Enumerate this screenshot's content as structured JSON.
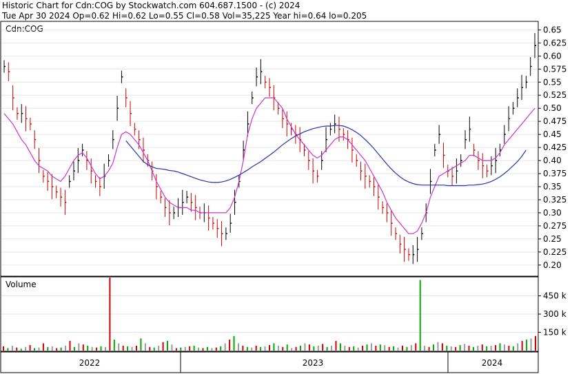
{
  "header": {
    "title": "Historic Chart for Cdn:COG by Stockwatch.com 604.687.1500 - (c) 2024",
    "stats": "Tue Apr 30 2024  Op=0.62  Hi=0.62  Lo=0.55  Cl=0.58  Vol=35,225  Year hi=0.64  lo=0.205"
  },
  "colors": {
    "up": "#000000",
    "down": "#cc0000",
    "ma_short": "#cc33cc",
    "ma_long": "#2233aa",
    "vol_up": "#00aa00",
    "vol_down": "#cc0000",
    "vol_neutral": "#999999"
  },
  "chart_data": [
    {
      "type": "line",
      "label": "Cdn:COG",
      "y_ticks": [
        "0.65",
        "0.625",
        "0.60",
        "0.575",
        "0.55",
        "0.525",
        "0.50",
        "0.475",
        "0.45",
        "0.425",
        "0.40",
        "0.375",
        "0.35",
        "0.325",
        "0.30",
        "0.275",
        "0.25",
        "0.225",
        "0.20"
      ],
      "ylim": [
        0.18,
        0.665
      ],
      "x_labels": [
        "2022",
        "2023",
        "2024"
      ],
      "series": [
        {
          "name": "",
          "style": "ohlc",
          "values": [
            0.58,
            0.57,
            0.52,
            0.49,
            0.49,
            0.48,
            0.47,
            0.44,
            0.4,
            0.37,
            0.36,
            0.35,
            0.34,
            0.33,
            0.32,
            0.36,
            0.38,
            0.4,
            0.42,
            0.4,
            0.38,
            0.36,
            0.35,
            0.37,
            0.4,
            0.44,
            0.5,
            0.56,
            0.52,
            0.49,
            0.46,
            0.44,
            0.42,
            0.4,
            0.38,
            0.35,
            0.33,
            0.31,
            0.3,
            0.3,
            0.31,
            0.32,
            0.33,
            0.32,
            0.31,
            0.3,
            0.3,
            0.29,
            0.28,
            0.27,
            0.26,
            0.26,
            0.28,
            0.32,
            0.36,
            0.42,
            0.47,
            0.52,
            0.56,
            0.57,
            0.55,
            0.54,
            0.52,
            0.5,
            0.48,
            0.47,
            0.46,
            0.45,
            0.44,
            0.42,
            0.4,
            0.38,
            0.37,
            0.4,
            0.44,
            0.46,
            0.47,
            0.46,
            0.45,
            0.44,
            0.42,
            0.4,
            0.38,
            0.37,
            0.36,
            0.35,
            0.33,
            0.31,
            0.3,
            0.28,
            0.26,
            0.24,
            0.23,
            0.22,
            0.22,
            0.23,
            0.26,
            0.3,
            0.36,
            0.42,
            0.45,
            0.41,
            0.38,
            0.37,
            0.38,
            0.4,
            0.44,
            0.46,
            0.42,
            0.4,
            0.39,
            0.38,
            0.39,
            0.4,
            0.42,
            0.45,
            0.48,
            0.5,
            0.52,
            0.54,
            0.55,
            0.58,
            0.62
          ]
        },
        {
          "name": "",
          "values": [
            0.49,
            0.48,
            0.47,
            0.455,
            0.44,
            0.43,
            0.415,
            0.4,
            0.39,
            0.385,
            0.38,
            0.37,
            0.365,
            0.36,
            0.37,
            0.385,
            0.4,
            0.41,
            0.415,
            0.405,
            0.39,
            0.375,
            0.365,
            0.37,
            0.38,
            0.395,
            0.425,
            0.45,
            0.455,
            0.45,
            0.44,
            0.43,
            0.415,
            0.4,
            0.38,
            0.36,
            0.345,
            0.33,
            0.32,
            0.315,
            0.31,
            0.31,
            0.31,
            0.305,
            0.305,
            0.3,
            0.3,
            0.3,
            0.3,
            0.3,
            0.3,
            0.3,
            0.31,
            0.33,
            0.36,
            0.4,
            0.45,
            0.48,
            0.5,
            0.51,
            0.52,
            0.52,
            0.52,
            0.51,
            0.5,
            0.48,
            0.465,
            0.45,
            0.44,
            0.43,
            0.42,
            0.41,
            0.405,
            0.41,
            0.42,
            0.43,
            0.44,
            0.445,
            0.445,
            0.44,
            0.43,
            0.42,
            0.41,
            0.4,
            0.385,
            0.37,
            0.355,
            0.34,
            0.32,
            0.305,
            0.29,
            0.28,
            0.27,
            0.26,
            0.26,
            0.265,
            0.28,
            0.3,
            0.33,
            0.35,
            0.37,
            0.375,
            0.38,
            0.385,
            0.39,
            0.395,
            0.4,
            0.41,
            0.41,
            0.405,
            0.4,
            0.4,
            0.4,
            0.405,
            0.415,
            0.43,
            0.44,
            0.45,
            0.46,
            0.47,
            0.48,
            0.49,
            0.5
          ]
        },
        {
          "name": "",
          "values": [
            null,
            null,
            null,
            null,
            null,
            null,
            null,
            null,
            null,
            null,
            null,
            null,
            null,
            null,
            null,
            null,
            null,
            null,
            null,
            null,
            null,
            null,
            null,
            null,
            null,
            null,
            null,
            null,
            0.438,
            0.428,
            0.418,
            0.408,
            0.398,
            0.392,
            0.388,
            0.385,
            0.384,
            0.383,
            0.381,
            0.38,
            0.378,
            0.375,
            0.372,
            0.369,
            0.366,
            0.363,
            0.361,
            0.359,
            0.358,
            0.358,
            0.359,
            0.361,
            0.364,
            0.368,
            0.372,
            0.377,
            0.382,
            0.388,
            0.393,
            0.398,
            0.404,
            0.41,
            0.416,
            0.423,
            0.43,
            0.436,
            0.442,
            0.447,
            0.451,
            0.455,
            0.458,
            0.461,
            0.463,
            0.465,
            0.466,
            0.466,
            0.467,
            0.467,
            0.466,
            0.463,
            0.459,
            0.454,
            0.448,
            0.44,
            0.432,
            0.423,
            0.413,
            0.403,
            0.393,
            0.384,
            0.376,
            0.369,
            0.363,
            0.359,
            0.356,
            0.354,
            0.353,
            0.353,
            0.353,
            0.353,
            0.353,
            0.353,
            0.352,
            0.352,
            0.352,
            0.352,
            0.352,
            0.353,
            0.353,
            0.354,
            0.355,
            0.357,
            0.36,
            0.364,
            0.369,
            0.375,
            0.382,
            0.39,
            0.398,
            0.408,
            0.42
          ]
        }
      ]
    },
    {
      "type": "bar",
      "label": "Volume",
      "y_ticks": [
        "450 k",
        "300 k",
        "150 k"
      ],
      "ylim": [
        0,
        600
      ],
      "series": [
        {
          "name": "Volume",
          "values": [
            35,
            20,
            40,
            25,
            15,
            30,
            45,
            20,
            25,
            60,
            30,
            35,
            20,
            25,
            40,
            80,
            30,
            60,
            50,
            40,
            30,
            25,
            35,
            30,
            600,
            90,
            60,
            40,
            35,
            30,
            40,
            100,
            60,
            30,
            25,
            40,
            70,
            80,
            50,
            20,
            25,
            30,
            35,
            40,
            25,
            20,
            30,
            20,
            25,
            35,
            60,
            90,
            120,
            60,
            40,
            30,
            25,
            40,
            30,
            35,
            45,
            60,
            40,
            30,
            50,
            20,
            30,
            40,
            60,
            50,
            35,
            40,
            55,
            30,
            40,
            80,
            60,
            40,
            30,
            35,
            25,
            40,
            50,
            60,
            40,
            50,
            45,
            30,
            35,
            25,
            40,
            30,
            45,
            60,
            580,
            40,
            30,
            50,
            70,
            60,
            40,
            35,
            30,
            45,
            55,
            40,
            30,
            40,
            50,
            35,
            40,
            45,
            60,
            50,
            40,
            35,
            60,
            80,
            90,
            100,
            120
          ]
        }
      ]
    }
  ]
}
